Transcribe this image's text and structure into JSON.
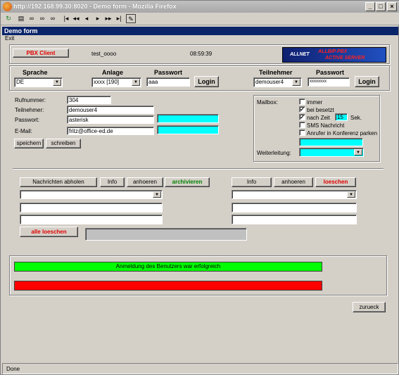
{
  "window": {
    "title": "http://192.168.99.30:8020 - Demo form - Mozilla Firefox"
  },
  "app": {
    "header": "Demo form",
    "menu_exit": "Exit"
  },
  "top": {
    "pbx_button": "PBX Client",
    "user": "test_oooo",
    "time": "08:59:39",
    "logo_text_1": "ALLNET",
    "logo_text_2": "ALLBIP PBX",
    "logo_text_3": "ACTIVE SERVER"
  },
  "login": {
    "sprache_label": "Sprache",
    "sprache_value": "DE",
    "anlage_label": "Anlage",
    "anlage_value": "xxxx [190]",
    "passwort_label": "Passwort",
    "passwort_value": "aaa",
    "login_button": "Login",
    "teilnehmer_label": "Teilnehmer",
    "teilnehmer_value": "demouser4",
    "passwort2_label": "Passwort",
    "passwort2_value": "xxxxxxxx",
    "login2_button": "Login"
  },
  "user": {
    "rufnummer_label": "Rufnummer:",
    "rufnummer_value": "304",
    "teilnehmer_label": "Teilnehmer:",
    "teilnehmer_value": "demouser4",
    "passwort_label": "Passwort:",
    "passwort_value": "asterisk",
    "email_label": "E-Mail:",
    "email_value": "fritz@office-ed.de",
    "speichern_button": "speichern",
    "schreiben_button": "schreiben"
  },
  "mailbox": {
    "label": "Mailbox:",
    "opt_immer": "immer",
    "opt_immer_checked": "",
    "opt_besetzt": "bei besetzt",
    "opt_besetzt_checked": "✓",
    "opt_nachzeit": "nach Zeit",
    "opt_nachzeit_checked": "✓",
    "zeit_value": "15",
    "sek": "Sek.",
    "opt_sms": "SMS Nachricht",
    "opt_sms_checked": "",
    "opt_konferenz": "Anrufer in Konferenz parken",
    "opt_konferenz_checked": "",
    "weiterleitung_label": "Weiterleitung:"
  },
  "messages": {
    "abholen_button": "Nachrichten abholen",
    "info_button": "Info",
    "anhoeren_button": "anhoeren",
    "archivieren_button": "archivieren",
    "info2_button": "Info",
    "anhoeren2_button": "anhoeren",
    "loeschen_button": "loeschen",
    "alle_loeschen_button": "alle loeschen"
  },
  "statusbars": {
    "green_text": "Anmeldung des Benutzers war erfolgreich",
    "green_color": "#00ff00",
    "red_color": "#ff0000"
  },
  "nav": {
    "zurueck_button": "zurueck"
  },
  "browser_status": "Done"
}
